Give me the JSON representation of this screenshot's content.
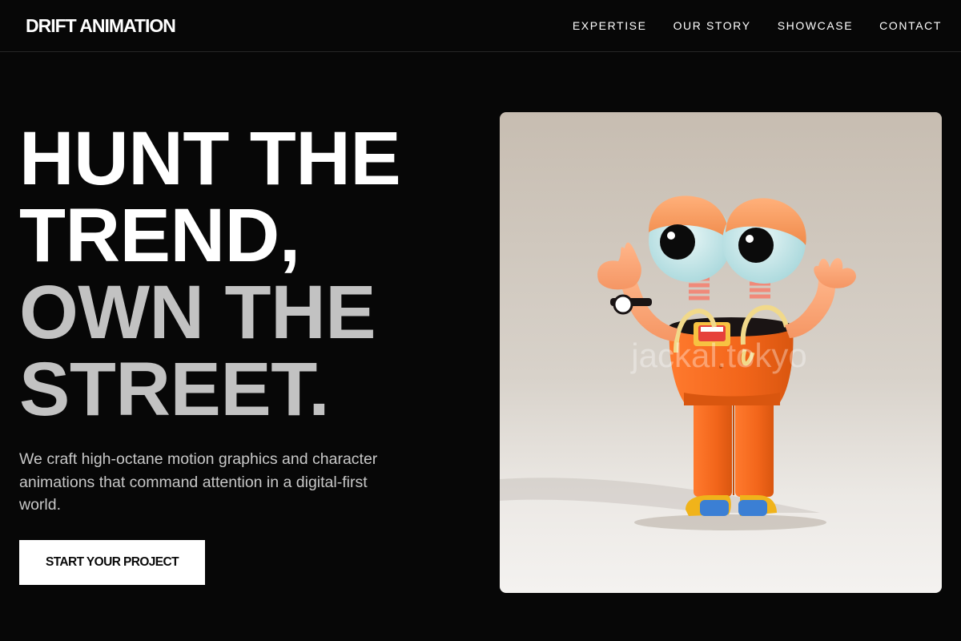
{
  "brand": {
    "logo_text": "DRIFT ANIMATION"
  },
  "nav": {
    "items": [
      {
        "label": "EXPERTISE"
      },
      {
        "label": "OUR STORY"
      },
      {
        "label": "SHOWCASE"
      },
      {
        "label": "CONTACT"
      }
    ]
  },
  "hero": {
    "title_lines": [
      "HUNT THE",
      "TREND,",
      "OWN THE",
      "STREET."
    ],
    "subtitle": "We craft high-octane motion graphics and character animations that command attention in a digital-first world.",
    "cta_label": "START YOUR PROJECT",
    "image": {
      "description_icon": "character-illustration",
      "watermark": "jackal.tokyo"
    }
  },
  "colors": {
    "background": "#070707",
    "text_primary": "#ffffff",
    "text_muted": "#c2c2c2",
    "character_orange": "#f26b1d",
    "shoe_blue": "#3b7fd4",
    "shoe_yellow": "#f0b31a"
  }
}
